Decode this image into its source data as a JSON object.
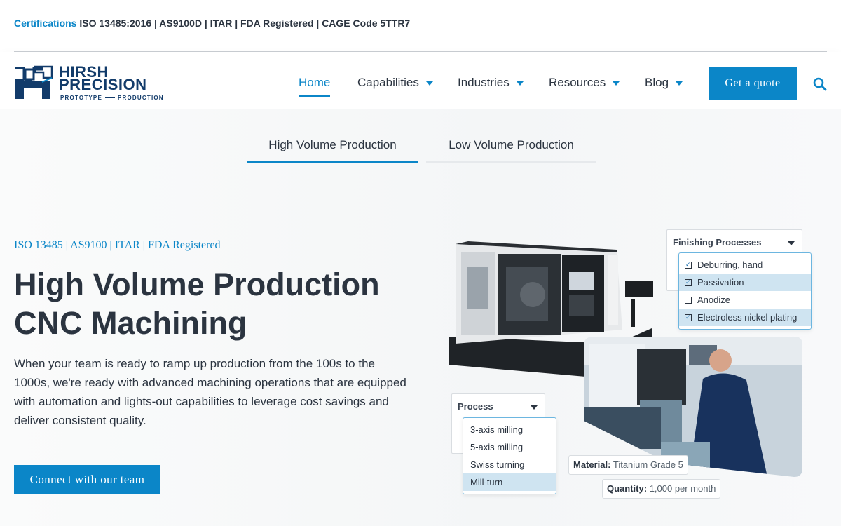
{
  "topbar": {
    "cert_label": "Certifications",
    "cert_text": "ISO 13485:2016 | AS9100D | ITAR | FDA Registered | CAGE Code 5TTR7"
  },
  "brand": {
    "name_line1": "HIRSH",
    "name_line2": "PRECISION",
    "tagline_left": "PROTOTYPE",
    "tagline_right": "PRODUCTION"
  },
  "nav": {
    "items": [
      {
        "label": "Home",
        "active": true,
        "dropdown": false
      },
      {
        "label": "Capabilities",
        "active": false,
        "dropdown": true
      },
      {
        "label": "Industries",
        "active": false,
        "dropdown": true
      },
      {
        "label": "Resources",
        "active": false,
        "dropdown": true
      },
      {
        "label": "Blog",
        "active": false,
        "dropdown": true
      }
    ],
    "cta_label": "Get a quote",
    "search_icon": "search-icon"
  },
  "tabs": [
    {
      "label": "High Volume Production",
      "active": true
    },
    {
      "label": "Low Volume Production",
      "active": false
    }
  ],
  "hero": {
    "eyebrow": "ISO 13485 | AS9100 | ITAR | FDA Registered",
    "headline": "High Volume Production CNC Machining",
    "body": "When your team is ready to ramp up production from the 100s to the 1000s, we're ready with advanced machining operations that are equipped with automation and lights-out capabilities to leverage cost savings and deliver consistent quality.",
    "cta_label": "Connect with our team"
  },
  "illustration": {
    "finishing": {
      "label": "Finishing Processes",
      "options": [
        {
          "label": "Deburring, hand",
          "checked": true,
          "highlighted": false
        },
        {
          "label": "Passivation",
          "checked": true,
          "highlighted": true
        },
        {
          "label": "Anodize",
          "checked": false,
          "highlighted": false
        },
        {
          "label": "Electroless nickel plating",
          "checked": true,
          "highlighted": true
        }
      ]
    },
    "process": {
      "label": "Process",
      "options": [
        {
          "label": "3-axis milling",
          "highlighted": false
        },
        {
          "label": "5-axis milling",
          "highlighted": false
        },
        {
          "label": "Swiss turning",
          "highlighted": false
        },
        {
          "label": "Mill-turn",
          "highlighted": true
        }
      ]
    },
    "material": {
      "label": "Material:",
      "value": "Titanium Grade 5"
    },
    "quantity": {
      "label": "Quantity:",
      "value": "1,000 per month"
    }
  },
  "colors": {
    "accent": "#0b86c8",
    "navy": "#123b6a",
    "text": "#2b3440",
    "highlight": "#cfe4f1"
  }
}
